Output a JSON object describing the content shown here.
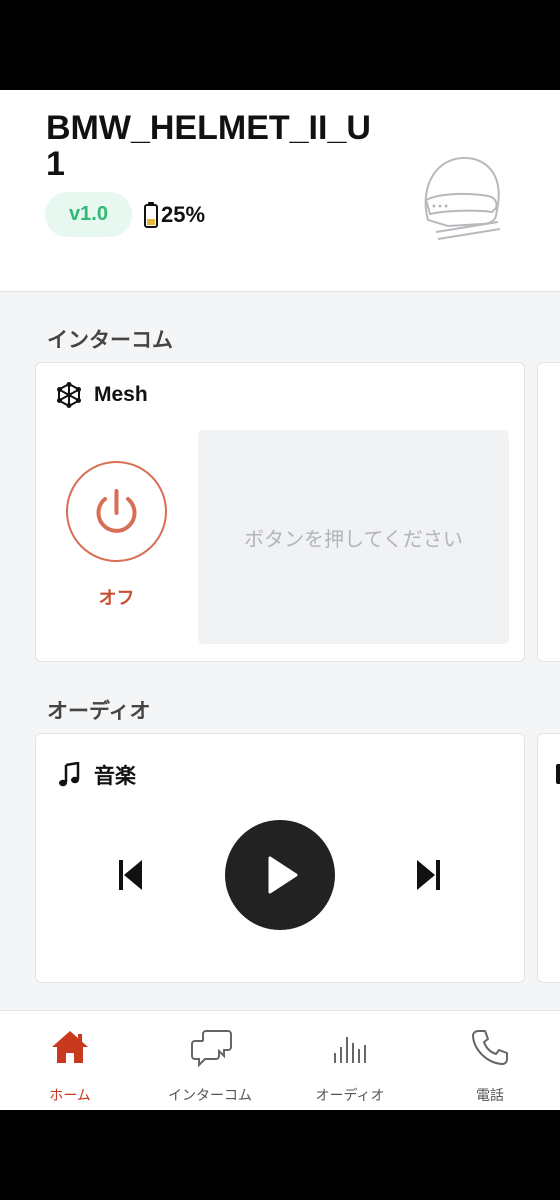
{
  "device": {
    "name": "BMW_HELMET_II_U1",
    "version": "v1.0",
    "battery": "25%"
  },
  "sections": {
    "intercom_title": "インターコム",
    "audio_title": "オーディオ"
  },
  "mesh_card": {
    "title": "Mesh",
    "power_state": "オフ",
    "hint": "ボタンを押してください"
  },
  "music_card": {
    "title": "音楽"
  },
  "nav": {
    "items": [
      {
        "label": "ホーム",
        "icon": "home-icon",
        "active": true
      },
      {
        "label": "インターコム",
        "icon": "chat-icon",
        "active": false
      },
      {
        "label": "オーディオ",
        "icon": "equalizer-icon",
        "active": false
      },
      {
        "label": "電話",
        "icon": "phone-icon",
        "active": false
      }
    ]
  },
  "colors": {
    "accent_red": "#c8502f",
    "version_green": "#2dbb75",
    "battery_yellow": "#e6b73a"
  }
}
